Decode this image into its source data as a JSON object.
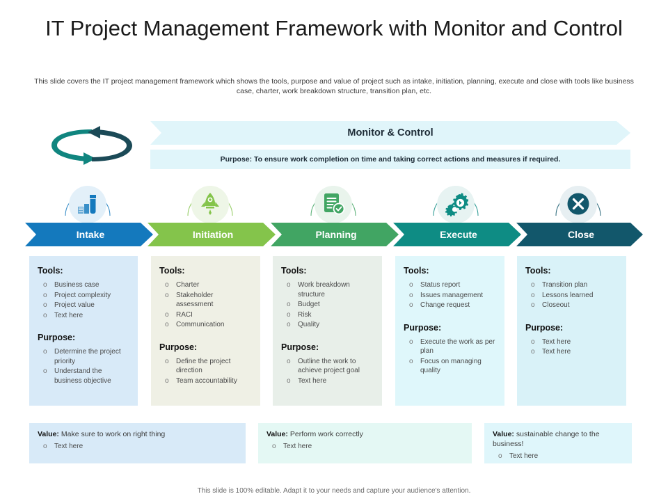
{
  "slide": {
    "title": "IT Project Management Framework with Monitor and Control",
    "subtitle": "This slide covers the IT project management framework which shows the tools, purpose and value of project such as intake, initiation, planning, execute and close with tools like business case, charter, work breakdown structure, transition plan, etc.",
    "footer": "This slide is 100% editable. Adapt it to your needs and capture your audience's attention."
  },
  "monitor": {
    "banner_label": "Monitor & Control",
    "purpose_text": "Purpose: To ensure work completion on time and taking correct actions and measures if required.",
    "banner_color": "#e0f5fa",
    "cycle_icon_colors": {
      "left": "#10857f",
      "right": "#1b4a57"
    }
  },
  "headings": {
    "tools": "Tools:",
    "purpose": "Purpose:"
  },
  "phases": [
    {
      "name": "Intake",
      "icon": "inbox-tray-icon",
      "color": "#1479bd",
      "disc_color": "#e3f0f9",
      "card_bg": "#d8eaf8",
      "tools": [
        "Business case",
        "Project complexity",
        "Project value",
        "Text here"
      ],
      "purpose": [
        "Determine the project priority",
        "Understand the business objective"
      ]
    },
    {
      "name": "Initiation",
      "icon": "rocket-icon",
      "color": "#84c44b",
      "disc_color": "#eef6e7",
      "card_bg": "#eff0e5",
      "tools": [
        "Charter",
        "Stakeholder assessment",
        "RACI",
        "Communication"
      ],
      "purpose": [
        "Define the project direction",
        "Team accountability"
      ]
    },
    {
      "name": "Planning",
      "icon": "document-check-icon",
      "color": "#41a563",
      "disc_color": "#e9f4ec",
      "card_bg": "#e8efe9",
      "tools": [
        "Work breakdown structure",
        "Budget",
        "Risk",
        "Quality"
      ],
      "purpose": [
        "Outline the work to achieve project goal",
        "Text here"
      ]
    },
    {
      "name": "Execute",
      "icon": "gears-icon",
      "color": "#0e8c84",
      "disc_color": "#e7f3f2",
      "card_bg": "#dff7fb",
      "tools": [
        "Status report",
        "Issues management",
        "Change request"
      ],
      "purpose": [
        "Execute the work as per plan",
        "Focus on managing quality"
      ]
    },
    {
      "name": "Close",
      "icon": "close-circle-icon",
      "color": "#12576b",
      "disc_color": "#e7eff2",
      "card_bg": "#d9f2f8",
      "tools": [
        "Transition plan",
        "Lessons learned",
        "Closeout"
      ],
      "purpose": [
        "Text here",
        "Text here"
      ]
    }
  ],
  "values": [
    {
      "label": "Value:",
      "text": "Make sure to work on right thing",
      "bullets": [
        "Text here"
      ],
      "bg": "#d8eaf8"
    },
    {
      "label": "Value:",
      "text": "Perform work correctly",
      "bullets": [
        "Text here"
      ],
      "bg": "#e4f8f4"
    },
    {
      "label": "Value:",
      "text": "sustainable change to the business!",
      "bullets": [
        "Text here"
      ],
      "bg": "#dff6fb"
    }
  ]
}
